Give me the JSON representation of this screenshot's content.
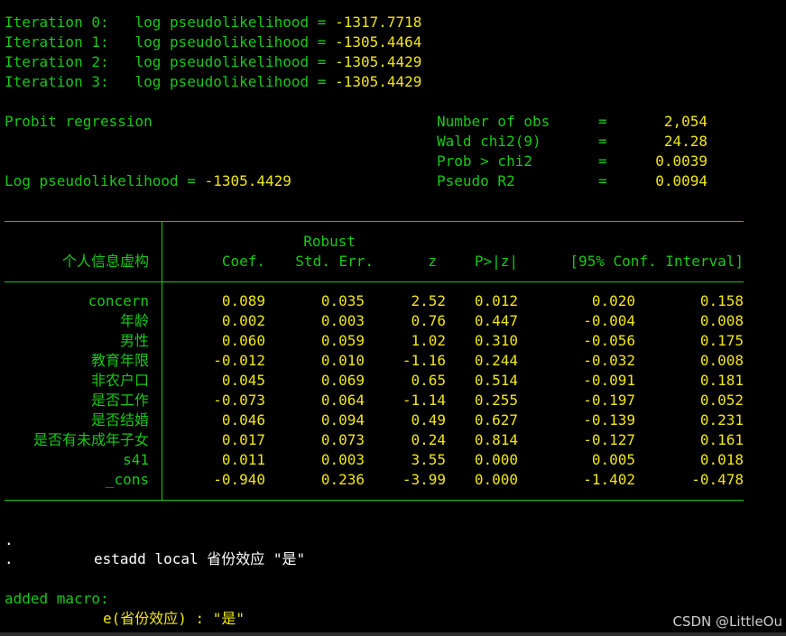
{
  "iterations": [
    {
      "label": "Iteration 0:",
      "stat_label": "log pseudolikelihood =",
      "value": "-1317.7718"
    },
    {
      "label": "Iteration 1:",
      "stat_label": "log pseudolikelihood =",
      "value": "-1305.4464"
    },
    {
      "label": "Iteration 2:",
      "stat_label": "log pseudolikelihood =",
      "value": "-1305.4429"
    },
    {
      "label": "Iteration 3:",
      "stat_label": "log pseudolikelihood =",
      "value": "-1305.4429"
    }
  ],
  "model": {
    "title": "Probit regression",
    "loglik_label": "Log pseudolikelihood =",
    "loglik_value": "-1305.4429",
    "stats": [
      {
        "label": "Number of obs",
        "eq": "=",
        "value": "2,054"
      },
      {
        "label": "Wald chi2(9)",
        "eq": "=",
        "value": "24.28"
      },
      {
        "label": "Prob > chi2",
        "eq": "=",
        "value": "0.0039"
      },
      {
        "label": "Pseudo R2",
        "eq": "=",
        "value": "0.0094"
      }
    ]
  },
  "table": {
    "depvar": "个人信息虚构",
    "robust_label": "Robust",
    "headers": {
      "coef": "Coef.",
      "se": "Std. Err.",
      "z": "z",
      "p": "P>|z|",
      "ci": "[95% Conf. Interval]"
    },
    "rows": [
      {
        "var": "concern",
        "coef": "0.089",
        "se": "0.035",
        "z": "2.52",
        "p": "0.012",
        "lo": "0.020",
        "hi": "0.158"
      },
      {
        "var": "年龄",
        "coef": "0.002",
        "se": "0.003",
        "z": "0.76",
        "p": "0.447",
        "lo": "-0.004",
        "hi": "0.008"
      },
      {
        "var": "男性",
        "coef": "0.060",
        "se": "0.059",
        "z": "1.02",
        "p": "0.310",
        "lo": "-0.056",
        "hi": "0.175"
      },
      {
        "var": "教育年限",
        "coef": "-0.012",
        "se": "0.010",
        "z": "-1.16",
        "p": "0.244",
        "lo": "-0.032",
        "hi": "0.008"
      },
      {
        "var": "非农户口",
        "coef": "0.045",
        "se": "0.069",
        "z": "0.65",
        "p": "0.514",
        "lo": "-0.091",
        "hi": "0.181"
      },
      {
        "var": "是否工作",
        "coef": "-0.073",
        "se": "0.064",
        "z": "-1.14",
        "p": "0.255",
        "lo": "-0.197",
        "hi": "0.052"
      },
      {
        "var": "是否结婚",
        "coef": "0.046",
        "se": "0.094",
        "z": "0.49",
        "p": "0.627",
        "lo": "-0.139",
        "hi": "0.231"
      },
      {
        "var": "是否有未成年子女",
        "coef": "0.017",
        "se": "0.073",
        "z": "0.24",
        "p": "0.814",
        "lo": "-0.127",
        "hi": "0.161"
      },
      {
        "var": "s41",
        "coef": "0.011",
        "se": "0.003",
        "z": "3.55",
        "p": "0.000",
        "lo": "0.005",
        "hi": "0.018"
      },
      {
        "var": "_cons",
        "coef": "-0.940",
        "se": "0.236",
        "z": "-3.99",
        "p": "0.000",
        "lo": "-1.402",
        "hi": "-0.478"
      }
    ]
  },
  "commands": {
    "dot": ".",
    "cmd_prefix": ".",
    "cmd": "estadd local 省份效应 \"是\"",
    "added_macro": "added macro:",
    "macro_line": "e(省份效应) : \"是\""
  },
  "watermark": "CSDN @LittleOu",
  "colors": {
    "background": "#000000",
    "green": "#18c818",
    "yellow": "#f0e619",
    "white": "#ffffff"
  }
}
